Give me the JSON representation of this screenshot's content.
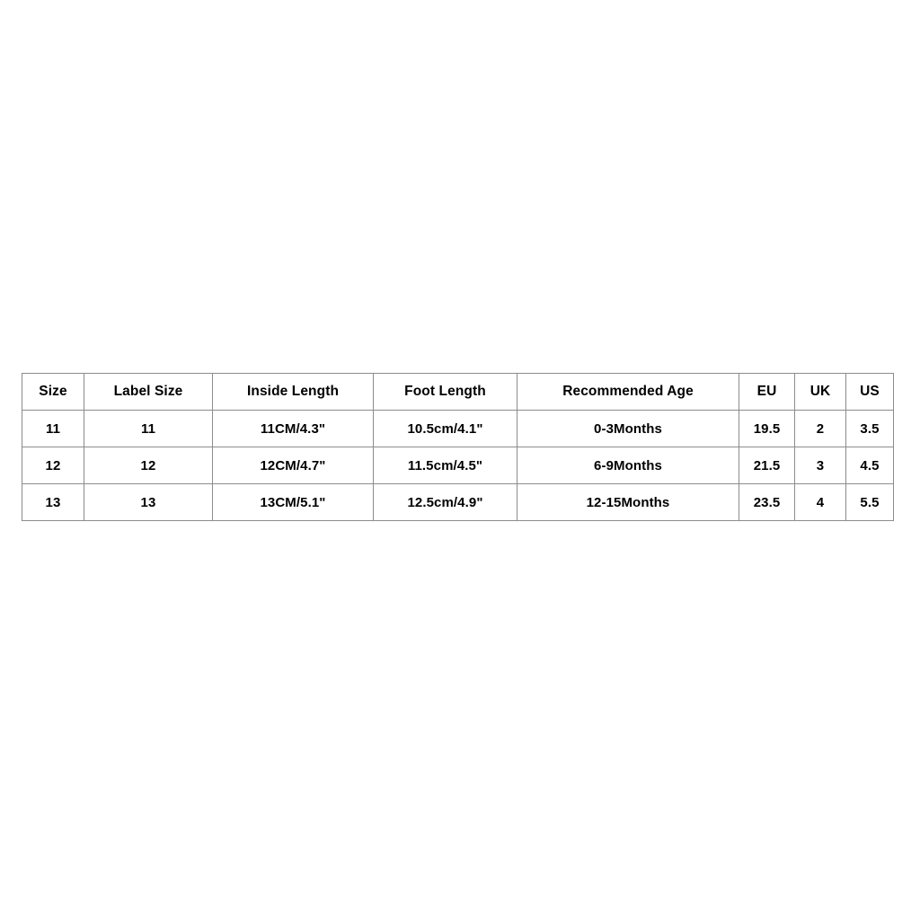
{
  "page": {
    "background_color": "#ffffff",
    "border_color": "#8c8c8c",
    "text_color": "#000000"
  },
  "table": {
    "title": "",
    "columns": [
      {
        "key": "size",
        "label": "Size"
      },
      {
        "key": "label_size",
        "label": "Label Size"
      },
      {
        "key": "inside_length",
        "label": "Inside Length"
      },
      {
        "key": "foot_length",
        "label": "Foot Length"
      },
      {
        "key": "recommended_age",
        "label": "Recommended Age"
      },
      {
        "key": "eu",
        "label": "EU"
      },
      {
        "key": "uk",
        "label": "UK"
      },
      {
        "key": "us",
        "label": "US"
      }
    ],
    "rows": [
      {
        "size": "11",
        "label_size": "11",
        "inside_length": "11CM/4.3\"",
        "foot_length": "10.5cm/4.1\"",
        "recommended_age": "0-3Months",
        "eu": "19.5",
        "uk": "2",
        "us": "3.5"
      },
      {
        "size": "12",
        "label_size": "12",
        "inside_length": "12CM/4.7\"",
        "foot_length": "11.5cm/4.5\"",
        "recommended_age": "6-9Months",
        "eu": "21.5",
        "uk": "3",
        "us": "4.5"
      },
      {
        "size": "13",
        "label_size": "13",
        "inside_length": "13CM/5.1\"",
        "foot_length": "12.5cm/4.9\"",
        "recommended_age": "12-15Months",
        "eu": "23.5",
        "uk": "4",
        "us": "5.5"
      }
    ]
  }
}
